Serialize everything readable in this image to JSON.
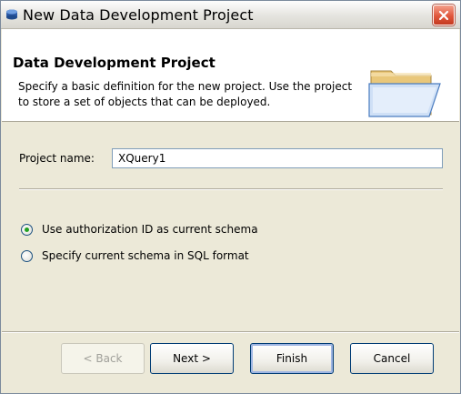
{
  "window": {
    "title": "New Data Development Project"
  },
  "header": {
    "title": "Data Development Project",
    "description": "Specify a basic definition for the new project.  Use the project to store a set of objects that can be deployed."
  },
  "form": {
    "project_name_label": "Project name:",
    "project_name_value": "XQuery1"
  },
  "options": [
    {
      "label": "Use authorization ID as current schema",
      "checked": true
    },
    {
      "label": "Specify current schema in SQL format",
      "checked": false
    }
  ],
  "buttons": {
    "back": "< Back",
    "next": "Next >",
    "finish": "Finish",
    "cancel": "Cancel"
  }
}
